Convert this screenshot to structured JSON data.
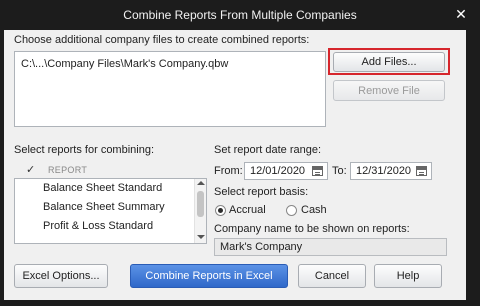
{
  "window": {
    "title": "Combine Reports From Multiple Companies",
    "close_glyph": "✕"
  },
  "files": {
    "label": "Choose additional company files to create combined reports:",
    "entries": [
      "C:\\...\\Company Files\\Mark's Company.qbw"
    ],
    "add_button": "Add Files...",
    "remove_button": "Remove File"
  },
  "reports": {
    "label": "Select reports for combining:",
    "check_header": "✓",
    "column_header": "REPORT",
    "items": [
      "Balance Sheet Standard",
      "Balance Sheet Summary",
      "Profit & Loss Standard"
    ]
  },
  "date_range": {
    "label": "Set report date range:",
    "from_label": "From:",
    "from_value": "12/01/2020",
    "to_label": "To:",
    "to_value": "12/31/2020"
  },
  "basis": {
    "label": "Select report basis:",
    "options": [
      "Accrual",
      "Cash"
    ],
    "selected": "Accrual"
  },
  "company_name": {
    "label": "Company name to be shown on reports:",
    "value": "Mark's Company"
  },
  "buttons": {
    "excel_options": "Excel Options...",
    "combine": "Combine Reports in Excel",
    "cancel": "Cancel",
    "help": "Help"
  },
  "colors": {
    "highlight_border": "#d6262c",
    "primary_button": "#2f68c9",
    "title_bar": "#1c1c1c"
  }
}
